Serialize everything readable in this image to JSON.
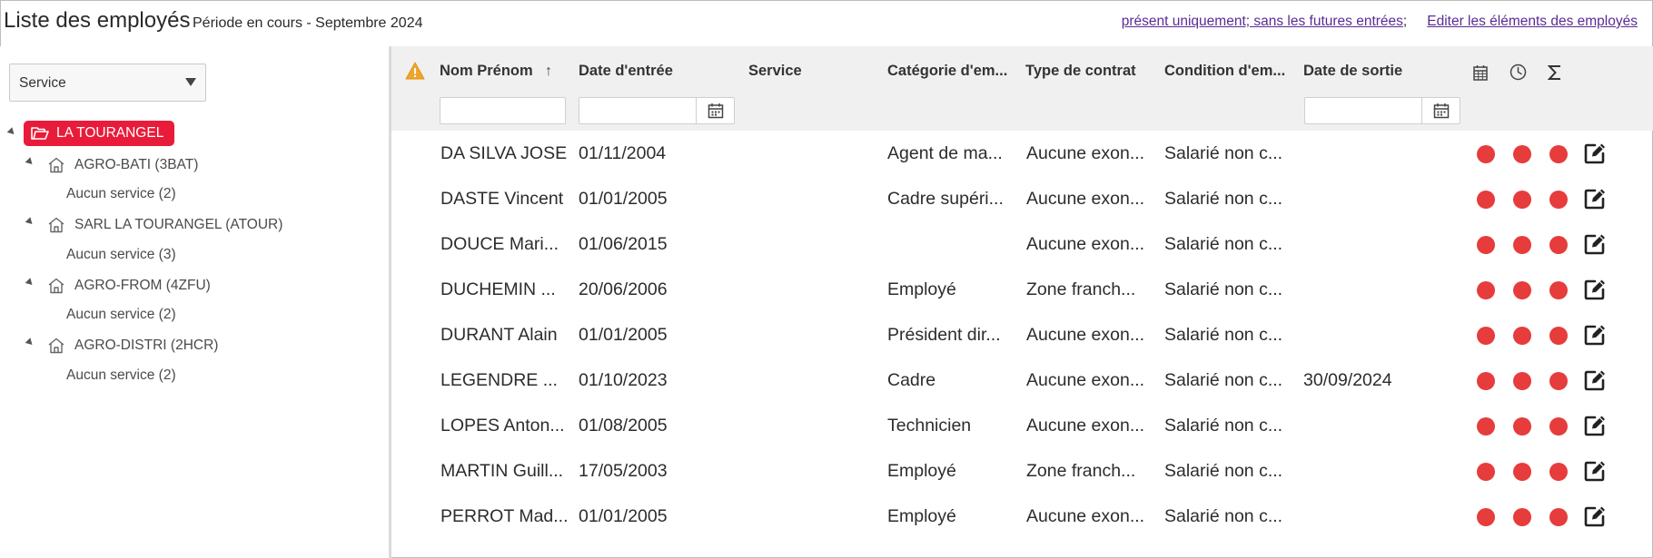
{
  "header": {
    "title": "Liste des employés",
    "period": "Période en cours - Septembre 2024",
    "link_present": "présent uniquement; sans les futures entrées",
    "link_sep": ";",
    "link_edit": "Editer les éléments des employés"
  },
  "sidebar": {
    "select_value": "Service",
    "root": "LA TOURANGEL",
    "companies": [
      {
        "label": "AGRO-BATI (3BAT)",
        "child": "Aucun service (2)"
      },
      {
        "label": "SARL LA TOURANGEL (ATOUR)",
        "child": "Aucun service (3)"
      },
      {
        "label": "AGRO-FROM (4ZFU)",
        "child": "Aucun service (2)"
      },
      {
        "label": "AGRO-DISTRI (2HCR)",
        "child": "Aucun service (2)"
      }
    ]
  },
  "table": {
    "columns": [
      "Nom Prénom",
      "Date d'entrée",
      "Service",
      "Catégorie d'em...",
      "Type de contrat",
      "Condition d'em...",
      "Date de sortie"
    ],
    "sort_indicator": "↑",
    "header_icons": [
      "warning-icon",
      "calendar-grid-icon",
      "clock-icon",
      "sigma-icon"
    ],
    "status_color": "#e63c3c",
    "rows": [
      [
        "DA SILVA JOSE",
        "01/11/2004",
        "",
        "Agent de ma...",
        "Aucune exon...",
        "Salarié non c...",
        ""
      ],
      [
        "DASTE Vincent",
        "01/01/2005",
        "",
        "Cadre supéri...",
        "Aucune exon...",
        "Salarié non c...",
        ""
      ],
      [
        "DOUCE Mari...",
        "01/06/2015",
        "",
        "",
        "Aucune exon...",
        "Salarié non c...",
        ""
      ],
      [
        "DUCHEMIN ...",
        "20/06/2006",
        "",
        "Employé",
        "Zone franch...",
        "Salarié non c...",
        ""
      ],
      [
        "DURANT Alain",
        "01/01/2005",
        "",
        "Président dir...",
        "Aucune exon...",
        "Salarié non c...",
        ""
      ],
      [
        "LEGENDRE ...",
        "01/10/2023",
        "",
        "Cadre",
        "Aucune exon...",
        "Salarié non c...",
        "30/09/2024"
      ],
      [
        "LOPES Anton...",
        "01/08/2005",
        "",
        "Technicien",
        "Aucune exon...",
        "Salarié non c...",
        ""
      ],
      [
        "MARTIN Guill...",
        "17/05/2003",
        "",
        "Employé",
        "Zone franch...",
        "Salarié non c...",
        ""
      ],
      [
        "PERROT Mad...",
        "01/01/2005",
        "",
        "Employé",
        "Aucune exon...",
        "Salarié non c...",
        ""
      ]
    ]
  }
}
